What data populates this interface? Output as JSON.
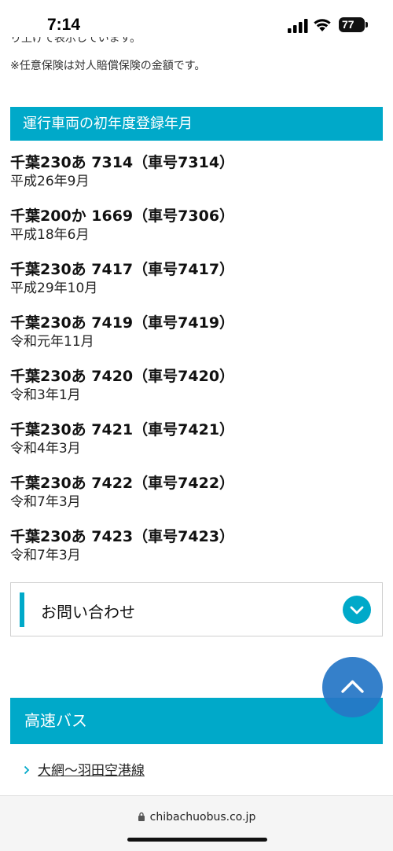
{
  "status_bar": {
    "time": "7:14",
    "battery": "77"
  },
  "notes": {
    "clipped_line": "り上げて表示しています。",
    "insurance_note": "※任意保険は対人賠償保険の金額です。"
  },
  "registration_section": {
    "title": "運行車両の初年度登録年月",
    "vehicles": [
      {
        "plate": "千葉230あ 7314（車号7314）",
        "date": "平成26年9月"
      },
      {
        "plate": "千葉200か 1669（車号7306）",
        "date": "平成18年6月"
      },
      {
        "plate": "千葉230あ 7417（車号7417）",
        "date": "平成29年10月"
      },
      {
        "plate": "千葉230あ 7419（車号7419）",
        "date": "令和元年11月"
      },
      {
        "plate": "千葉230あ 7420（車号7420）",
        "date": "令和3年1月"
      },
      {
        "plate": "千葉230あ 7421（車号7421）",
        "date": "令和4年3月"
      },
      {
        "plate": "千葉230あ 7422（車号7422）",
        "date": "令和7年3月"
      },
      {
        "plate": "千葉230あ 7423（車号7423）",
        "date": "令和7年3月"
      }
    ]
  },
  "inquiry": {
    "label": "お問い合わせ"
  },
  "highway_section": {
    "title": "高速バス",
    "link_label": "大網〜羽田空港線"
  },
  "browser": {
    "url": "chibachuobus.co.jp"
  },
  "icons": {
    "signal": "cellular-signal-icon",
    "wifi": "wifi-icon",
    "battery": "battery-icon",
    "toggle": "chevron-down-icon",
    "scroll_top": "chevron-up-icon",
    "link_chevron": "chevron-right-icon",
    "lock": "lock-icon"
  },
  "colors": {
    "accent": "#00a9c9",
    "scroll_button": "#2677c6"
  }
}
